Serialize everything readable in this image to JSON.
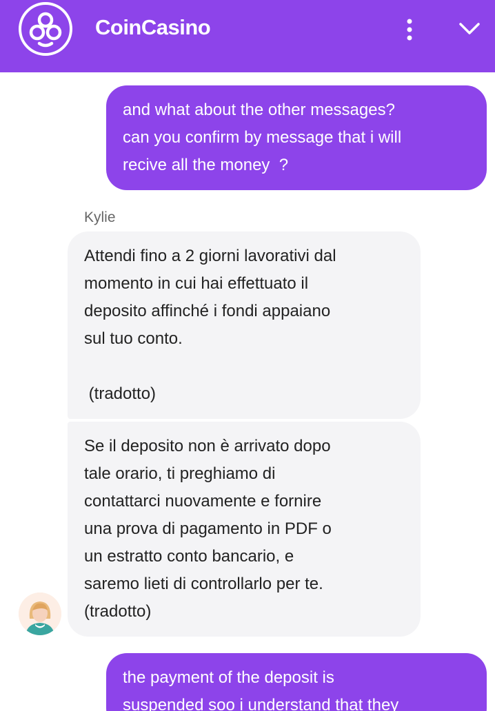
{
  "header": {
    "brand_name": "CoinCasino",
    "logo_icon": "coincasino-logo-icon",
    "menu_icon": "more-vertical-icon",
    "collapse_icon": "chevron-down-icon",
    "color": "#8d44ea"
  },
  "messages": [
    {
      "sender": "user",
      "text": "and what about the other messages?\ncan you confirm by message that i will\nrecive all the money  ?"
    },
    {
      "sender": "agent",
      "agent_name": "Kylie",
      "text": "Attendi fino a 2 giorni lavorativi dal\nmomento in cui hai effettuato il\ndeposito affinché i fondi appaiano\nsul tuo conto.\n\n (tradotto)"
    },
    {
      "sender": "agent",
      "text": "Se il deposito non è arrivato dopo\ntale orario, ti preghiamo di\ncontattarci nuovamente e fornire\nuna prova di pagamento in PDF o\nun estratto conto bancario, e\nsaremo lieti di controllarlo per te.\n(tradotto)"
    },
    {
      "sender": "user",
      "text": "the payment of the deposit is\nsuspended soo i understand that they"
    }
  ],
  "colors": {
    "user_bubble": "#8d44ea",
    "agent_bubble": "#f4f4f6"
  }
}
